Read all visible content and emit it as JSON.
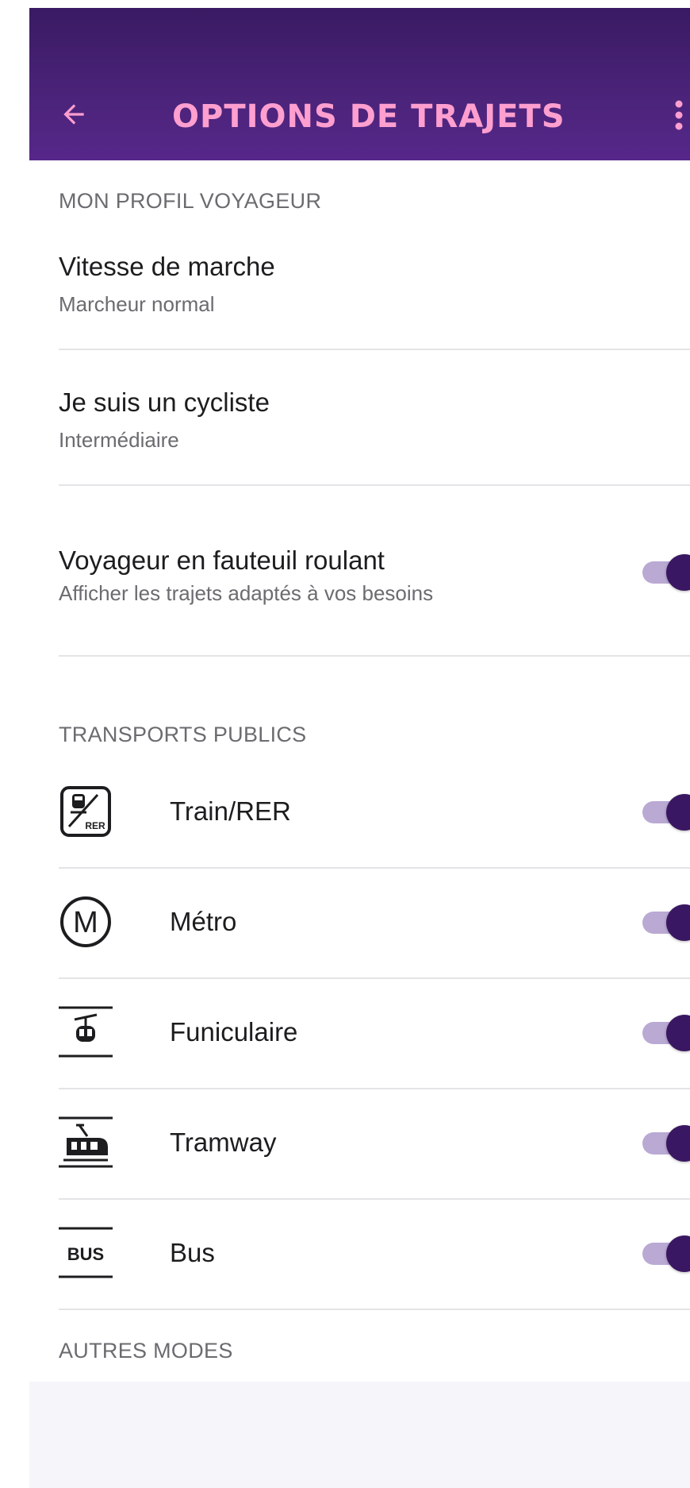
{
  "colors": {
    "header_bg": "#4a2378",
    "title_color": "#ff9fcf",
    "toggle_thumb": "#3a1762",
    "toggle_track": "#b9a9d3"
  },
  "header": {
    "back_icon": "arrow-left-icon",
    "title": "OPTIONS DE TRAJETS",
    "menu_icon": "more-vertical-icon"
  },
  "profile": {
    "section_title": "MON PROFIL VOYAGEUR",
    "walking_speed": {
      "title": "Vitesse de marche",
      "value": "Marcheur normal"
    },
    "cyclist": {
      "title": "Je suis un cycliste",
      "value": "Intermédiaire"
    },
    "wheelchair": {
      "title": "Voyageur en fauteuil roulant",
      "subtitle": "Afficher les trajets adaptés à vos besoins",
      "enabled": true
    }
  },
  "public_transport": {
    "section_title": "TRANSPORTS PUBLICS",
    "modes": [
      {
        "icon": "train-rer-icon",
        "label": "Train/RER",
        "enabled": true
      },
      {
        "icon": "metro-icon",
        "label": "Métro",
        "enabled": true
      },
      {
        "icon": "funicular-icon",
        "label": "Funiculaire",
        "enabled": true
      },
      {
        "icon": "tramway-icon",
        "label": "Tramway",
        "enabled": true
      },
      {
        "icon": "bus-icon",
        "label": "Bus",
        "icon_text": "BUS",
        "enabled": true
      }
    ]
  },
  "other_modes": {
    "section_title": "AUTRES MODES"
  },
  "icon_texts": {
    "rer": "RER",
    "metro": "M"
  }
}
